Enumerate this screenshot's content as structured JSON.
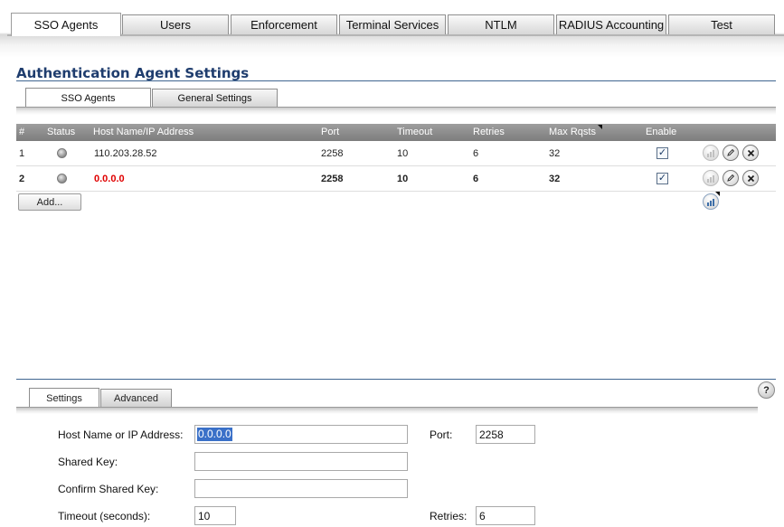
{
  "top_tabs": [
    {
      "label": "SSO Agents",
      "active": true
    },
    {
      "label": "Users"
    },
    {
      "label": "Enforcement"
    },
    {
      "label": "Terminal Services"
    },
    {
      "label": "NTLM"
    },
    {
      "label": "RADIUS Accounting"
    },
    {
      "label": "Test"
    }
  ],
  "section": {
    "title": "Authentication Agent Settings"
  },
  "sub_tabs": [
    {
      "label": "SSO Agents",
      "active": true
    },
    {
      "label": "General Settings"
    }
  ],
  "table": {
    "headers": [
      "#",
      "Status",
      "Host Name/IP Address",
      "Port",
      "Timeout",
      "Retries",
      "Max Rqsts",
      "Enable"
    ],
    "rows": [
      {
        "num": "1",
        "host": "110.203.28.52",
        "port": "2258",
        "timeout": "10",
        "retries": "6",
        "max": "32",
        "enabled": true,
        "bold": false
      },
      {
        "num": "2",
        "host": "0.0.0.0",
        "port": "2258",
        "timeout": "10",
        "retries": "6",
        "max": "32",
        "enabled": true,
        "bold": true
      }
    ],
    "add_label": "Add..."
  },
  "icons": {
    "stats": "bar-chart-icon",
    "edit": "pencil-icon",
    "delete": "close-icon",
    "help": "help-icon",
    "check": "✓"
  },
  "panel": {
    "tabs": [
      {
        "label": "Settings",
        "active": true
      },
      {
        "label": "Advanced"
      }
    ],
    "help_glyph": "?",
    "fields": {
      "host_label": "Host Name or IP Address:",
      "host_value": "0.0.0.0",
      "port_label": "Port:",
      "port_value": "2258",
      "shared_key_label": "Shared Key:",
      "shared_key_value": "",
      "confirm_key_label": "Confirm Shared Key:",
      "confirm_key_value": "",
      "timeout_label": "Timeout (seconds):",
      "timeout_value": "10",
      "retries_label": "Retries:",
      "retries_value": "6"
    }
  },
  "colors": {
    "title": "#1f3d6e",
    "rule": "#3f6591",
    "highlight_red": "#e00000",
    "selection": "#3a70c8"
  }
}
